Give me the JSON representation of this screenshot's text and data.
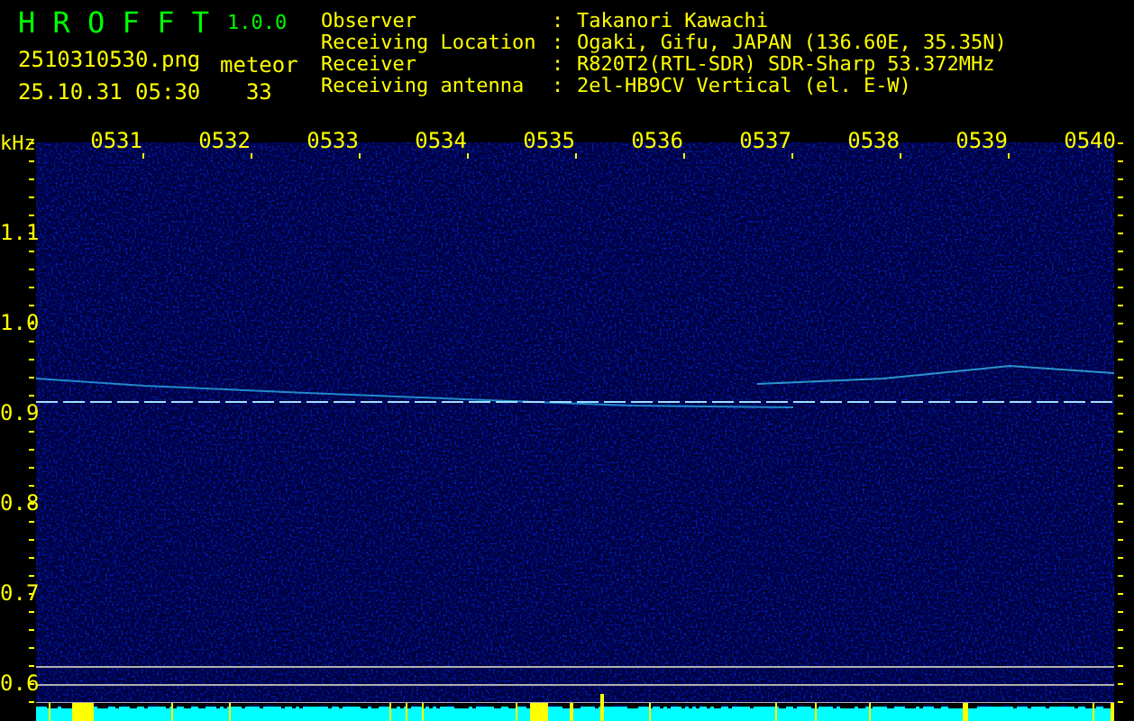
{
  "header": {
    "app_name": "H R O F F T",
    "version": "1.0.0",
    "filename": "2510310530.png",
    "datetime": "25.10.31 05:30",
    "meteor_label": "meteor",
    "meteor_count": "33"
  },
  "station_info": [
    {
      "label": "Observer",
      "sep": ":",
      "value": "Takanori Kawachi"
    },
    {
      "label": "Receiving Location",
      "sep": ":",
      "value": "Ogaki, Gifu, JAPAN (136.60E, 35.35N)"
    },
    {
      "label": "Receiver",
      "sep": ":",
      "value": "R820T2(RTL-SDR) SDR-Sharp 53.372MHz"
    },
    {
      "label": "Receiving antenna",
      "sep": ":",
      "value": "2el-HB9CV Vertical (el. E-W)"
    }
  ],
  "spectrogram": {
    "unit": "kHz",
    "time_labels": [
      "0531",
      "0532",
      "0533",
      "0534",
      "0535",
      "0536",
      "0537",
      "0538",
      "0539",
      "0540"
    ],
    "freq_labels": [
      "1.1",
      "1.0",
      "0.9",
      "0.8",
      "0.7",
      "0.6"
    ]
  }
}
